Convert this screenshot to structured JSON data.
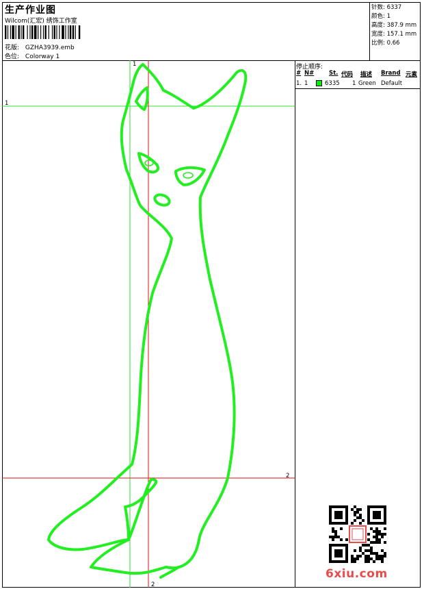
{
  "header": {
    "title": "生产作业图",
    "company": "Wilcom(汇宏) 绣饰工作室",
    "design_label": "花版:",
    "design_value": "GZHA3939.emb",
    "colorway_label": "色位:",
    "colorway_value": "Colorway 1"
  },
  "stats": [
    {
      "label": "针数:",
      "value": "6337"
    },
    {
      "label": "颜色:",
      "value": "1"
    },
    {
      "label": "高度:",
      "value": "387.9 mm"
    },
    {
      "label": "宽度:",
      "value": "157.1 mm"
    },
    {
      "label": "比例:",
      "value": "0.66"
    }
  ],
  "stop_sequence": {
    "title": "停止顺序:",
    "columns": [
      "#",
      "N#",
      "St.",
      "代码",
      "描述",
      "Brand",
      "元素"
    ],
    "rows": [
      {
        "index": "1.",
        "needle": "1",
        "stitches": "6335",
        "code": "1",
        "description": "Green",
        "brand": "Default",
        "swatch_color": "#00ee00"
      }
    ]
  },
  "guides": {
    "green_vertical_label": "1",
    "green_horizontal_label": "1",
    "red_horizontal_label": "2",
    "red_vertical_label": "2"
  },
  "colors": {
    "stitch": "#22ee22",
    "guide_green": "#33dd33",
    "guide_red": "#dd1111",
    "watermark": "#e94b4b"
  },
  "watermark": "6xiu.com"
}
